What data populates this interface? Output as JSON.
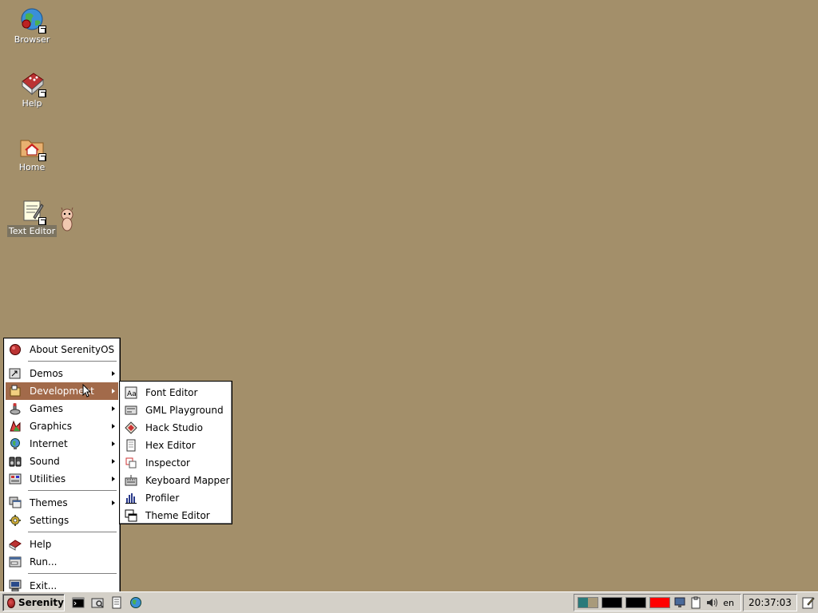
{
  "desktop": {
    "icons": [
      {
        "label": "Browser",
        "icon": "browser-globe-icon"
      },
      {
        "label": "Help",
        "icon": "help-book-icon"
      },
      {
        "label": "Home",
        "icon": "home-folder-icon"
      },
      {
        "label": "Text Editor",
        "icon": "text-editor-icon"
      }
    ],
    "background_color": "#a38f6a"
  },
  "start_menu": {
    "items": [
      {
        "label": "About SerenityOS",
        "icon": "serenity-logo-icon",
        "submenu": false
      },
      {
        "label": "Demos",
        "icon": "demos-icon",
        "submenu": true
      },
      {
        "label": "Development",
        "icon": "development-icon",
        "submenu": true,
        "active": true
      },
      {
        "label": "Games",
        "icon": "games-icon",
        "submenu": true
      },
      {
        "label": "Graphics",
        "icon": "graphics-icon",
        "submenu": true
      },
      {
        "label": "Internet",
        "icon": "internet-icon",
        "submenu": true
      },
      {
        "label": "Sound",
        "icon": "sound-icon",
        "submenu": true
      },
      {
        "label": "Utilities",
        "icon": "utilities-icon",
        "submenu": true
      },
      {
        "label": "Themes",
        "icon": "themes-icon",
        "submenu": true
      },
      {
        "label": "Settings",
        "icon": "settings-icon",
        "submenu": false
      },
      {
        "label": "Help",
        "icon": "help-icon",
        "submenu": false
      },
      {
        "label": "Run...",
        "icon": "run-icon",
        "submenu": false
      },
      {
        "label": "Exit...",
        "icon": "exit-icon",
        "submenu": false
      }
    ]
  },
  "development_menu": {
    "items": [
      {
        "label": "Font Editor",
        "icon": "font-editor-icon"
      },
      {
        "label": "GML Playground",
        "icon": "gml-playground-icon"
      },
      {
        "label": "Hack Studio",
        "icon": "hack-studio-icon"
      },
      {
        "label": "Hex Editor",
        "icon": "hex-editor-icon"
      },
      {
        "label": "Inspector",
        "icon": "inspector-icon"
      },
      {
        "label": "Keyboard Mapper",
        "icon": "keyboard-mapper-icon"
      },
      {
        "label": "Profiler",
        "icon": "profiler-icon"
      },
      {
        "label": "Theme Editor",
        "icon": "theme-editor-icon"
      }
    ]
  },
  "taskbar": {
    "start_label": "Serenity",
    "quick_launch": [
      "terminal-icon",
      "file-manager-icon",
      "text-editor-icon",
      "browser-icon"
    ],
    "tray": {
      "language": "en",
      "clock": "20:37:03",
      "graph_colors": [
        "#000000",
        "#000000",
        "#ff0000"
      ]
    }
  },
  "colors": {
    "menu_highlight": "#a26a4a",
    "taskbar": "#d4d0c8"
  }
}
